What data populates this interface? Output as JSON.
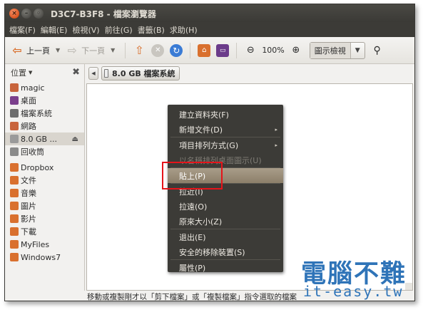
{
  "window": {
    "title": "D3C7-B3F8 - 檔案瀏覽器",
    "controls": {
      "close": "×",
      "min": "–",
      "max": "◦"
    }
  },
  "menubar": [
    "檔案(F)",
    "編輯(E)",
    "檢視(V)",
    "前往(G)",
    "書籤(B)",
    "求助(H)"
  ],
  "toolbar": {
    "back_label": "上一頁",
    "forward_label": "下一頁",
    "zoom_level": "100%",
    "view_mode": "圖示檢視"
  },
  "sidebar": {
    "header": "位置",
    "items": [
      {
        "label": "magic",
        "icon": "home-folder-icon",
        "color": "#c8643c"
      },
      {
        "label": "桌面",
        "icon": "desktop-icon",
        "color": "#7b3f8c"
      },
      {
        "label": "檔案系統",
        "icon": "filesystem-icon",
        "color": "#6d6d6d"
      },
      {
        "label": "網路",
        "icon": "network-icon",
        "color": "#c8643c"
      },
      {
        "label": "8.0 GB ...",
        "icon": "usb-drive-icon",
        "color": "#9a9a9a",
        "eject": "⏏"
      },
      {
        "label": "回收筒",
        "icon": "trash-icon",
        "color": "#8a8a8a"
      },
      {
        "label": "Dropbox",
        "icon": "folder-icon",
        "color": "#d9702e"
      },
      {
        "label": "文件",
        "icon": "documents-folder-icon",
        "color": "#d9702e"
      },
      {
        "label": "音樂",
        "icon": "music-folder-icon",
        "color": "#d9702e"
      },
      {
        "label": "圖片",
        "icon": "pictures-folder-icon",
        "color": "#d9702e"
      },
      {
        "label": "影片",
        "icon": "videos-folder-icon",
        "color": "#d9702e"
      },
      {
        "label": "下載",
        "icon": "downloads-folder-icon",
        "color": "#d9702e"
      },
      {
        "label": "MyFiles",
        "icon": "folder-icon",
        "color": "#d9702e"
      },
      {
        "label": "Windows7",
        "icon": "folder-icon",
        "color": "#d9702e"
      }
    ]
  },
  "pathbar": {
    "current": "8.0 GB 檔案系統"
  },
  "context_menu": [
    {
      "label": "建立資料夾(F)",
      "state": "normal"
    },
    {
      "label": "新增文件(D)",
      "state": "normal",
      "submenu": "▸"
    },
    {
      "sep": true
    },
    {
      "label": "項目排列方式(G)",
      "state": "normal",
      "submenu": "▸"
    },
    {
      "label": "以名稱排列桌面圖示(U)",
      "state": "disabled"
    },
    {
      "sep": true
    },
    {
      "label": "貼上(P)",
      "state": "highlighted"
    },
    {
      "sep": true
    },
    {
      "label": "拉近(I)",
      "state": "normal"
    },
    {
      "label": "拉遠(O)",
      "state": "normal"
    },
    {
      "label": "原來大小(Z)",
      "state": "normal"
    },
    {
      "sep": true
    },
    {
      "label": "退出(E)",
      "state": "normal"
    },
    {
      "label": "安全的移除裝置(S)",
      "state": "normal"
    },
    {
      "sep": true
    },
    {
      "label": "屬性(P)",
      "state": "normal"
    }
  ],
  "statusbar": {
    "text": "移動或複製剛才以「剪下檔案」或「複製檔案」指令選取的檔案"
  },
  "watermark": {
    "line1": "電腦不難",
    "line2": "it-easy.tw"
  },
  "colors": {
    "titlebar": "#3c3b37",
    "menu_highlight": "#8c7f6a",
    "annotation_box": "#e5141a",
    "watermark": "#2f74b8"
  }
}
